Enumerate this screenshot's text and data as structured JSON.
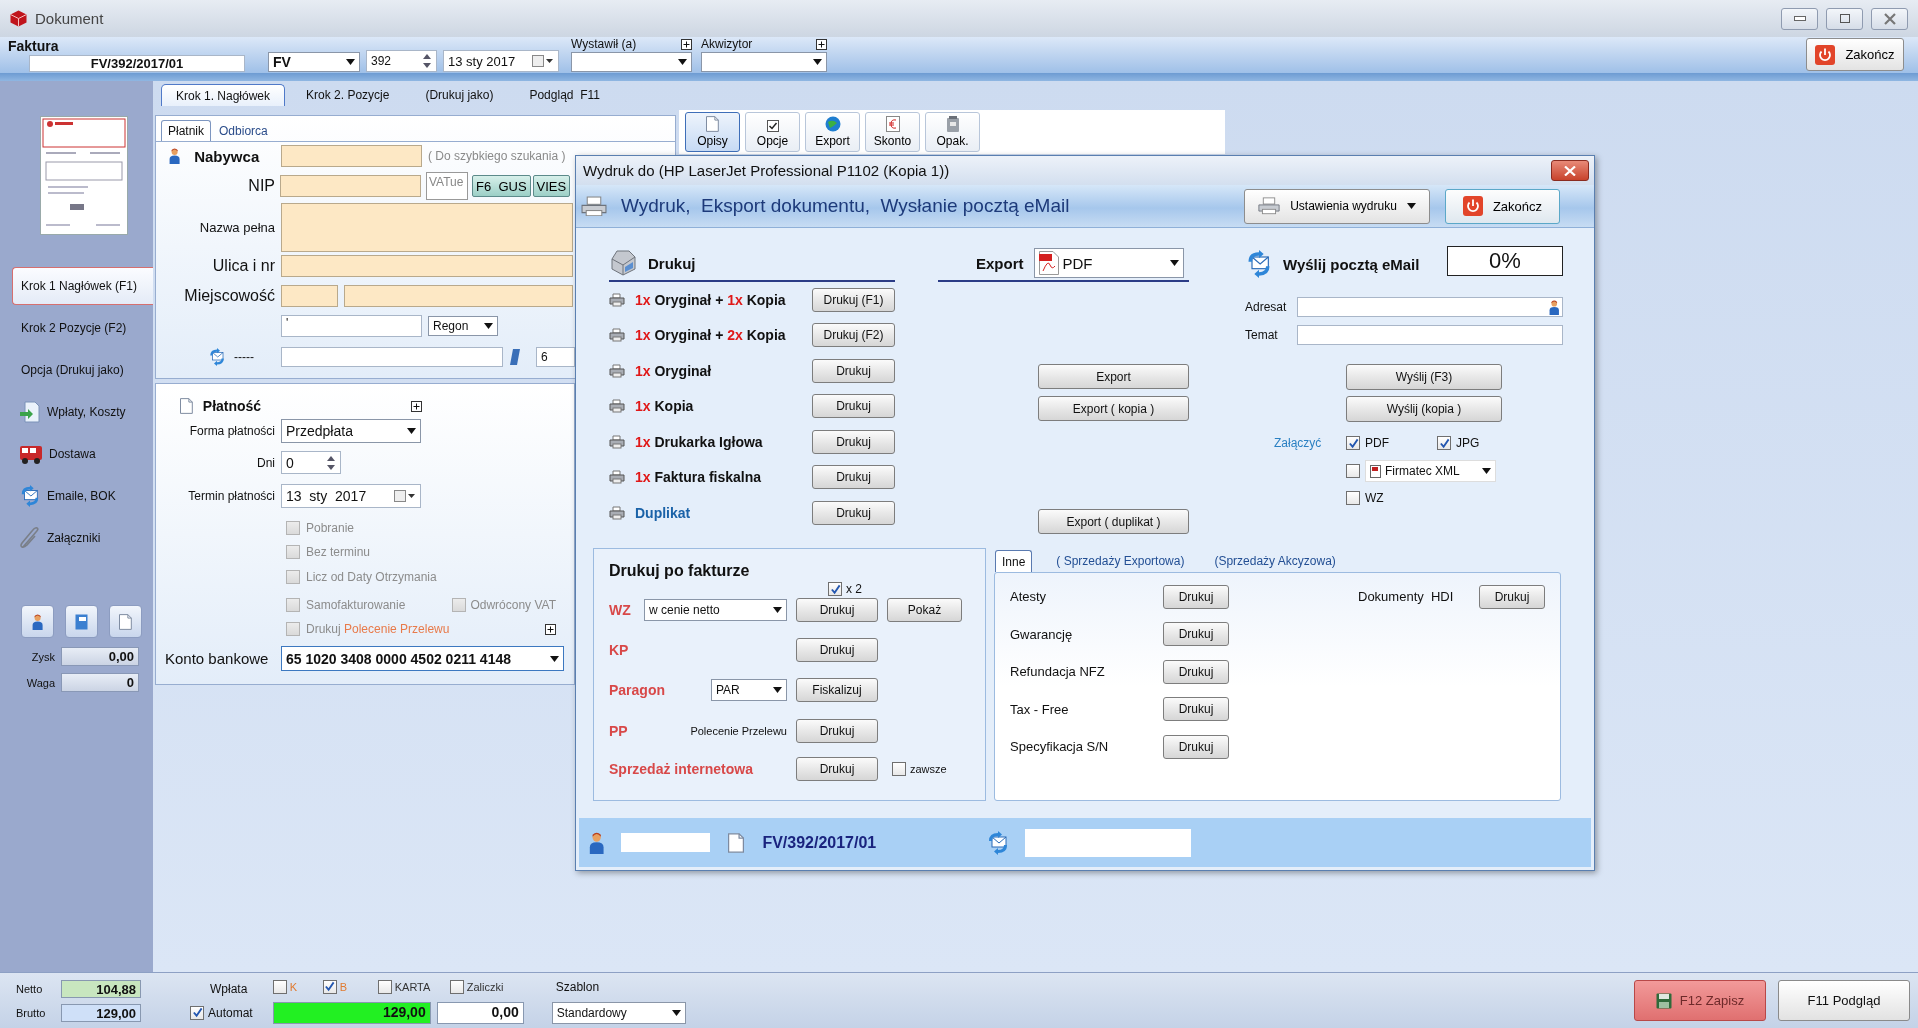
{
  "window": {
    "title": "Dokument"
  },
  "header": {
    "kind_label": "Faktura",
    "number": "FV/392/2017/01",
    "series": "FV",
    "sequence": "392",
    "date": "13 sty 2017",
    "issuer_label": "Wystawił (a)",
    "agent_label": "Akwizytor",
    "close_button": "Zakończ"
  },
  "steps": [
    {
      "label": "Krok 1. Nagłówek",
      "selected": true
    },
    {
      "label": "Krok 2. Pozycje",
      "selected": false
    },
    {
      "label": "(Drukuj jako)",
      "selected": false
    },
    {
      "label": "Podgląd  F11",
      "selected": false
    }
  ],
  "sidebar": {
    "items": [
      {
        "label": "Krok 1 Nagłówek (F1)",
        "kind": "step",
        "selected": true
      },
      {
        "label": "Krok 2 Pozycje (F2)",
        "kind": "step",
        "selected": false
      },
      {
        "label": "Opcja (Drukuj jako)",
        "kind": "step",
        "selected": false
      },
      {
        "label": "Wpłaty, Koszty",
        "kind": "link",
        "selected": false
      },
      {
        "label": "Dostawa",
        "kind": "link",
        "selected": false
      },
      {
        "label": "Emaile, BOK",
        "kind": "link",
        "selected": false
      },
      {
        "label": "Załączniki",
        "kind": "link",
        "selected": false
      }
    ],
    "stats": [
      {
        "label": "Zysk",
        "value": "0,00"
      },
      {
        "label": "Waga",
        "value": "0"
      }
    ]
  },
  "party": {
    "tabs": [
      {
        "label": "Płatnik",
        "selected": true
      },
      {
        "label": "Odbiorca",
        "selected": false
      }
    ],
    "title": "Nabywca",
    "search_hint": "( Do szybkiego szukania )",
    "nip_label": "NIP",
    "vat_ue": "VATue",
    "gus_button": "F6  GUS",
    "vies_button": "VIES",
    "full_name_label": "Nazwa pełna",
    "street_label": "Ulica i nr",
    "city_label": "Miejscowość",
    "id_value": "'",
    "id_type": "Regon",
    "phone_label": "-----",
    "phone_value": "6"
  },
  "toolbar": [
    {
      "label": "Opisy",
      "selected": true
    },
    {
      "label": "Opcje",
      "selected": false
    },
    {
      "label": "Export",
      "selected": false
    },
    {
      "label": "Skonto",
      "selected": false
    },
    {
      "label": "Opak.",
      "selected": false
    }
  ],
  "payment": {
    "title": "Płatność",
    "method_label": "Forma płatności",
    "method": "Przedpłata",
    "days_label": "Dni",
    "days": "0",
    "due_label": "Termin płatności",
    "due": "13  sty  2017",
    "options": [
      {
        "label": "Pobranie",
        "checked": false,
        "disabled": true
      },
      {
        "label": "Bez terminu",
        "checked": false,
        "disabled": true
      },
      {
        "label": "Licz od Daty Otrzymania",
        "checked": false,
        "disabled": true
      },
      {
        "label": "Samofakturowanie",
        "checked": false,
        "disabled": true
      },
      {
        "label": "Drukuj",
        "link": "Polecenie Przelewu",
        "checked": false,
        "disabled": true
      }
    ],
    "reverse_vat": {
      "label": "Odwrócony VAT",
      "checked": false,
      "disabled": true
    },
    "account_label": "Konto bankowe",
    "account": "65 1020 3408 0000 4502 0211 4148"
  },
  "print_dialog": {
    "title": "Wydruk do (HP LaserJet Professional P1102 (Kopia 1))",
    "heading": "Wydruk,  Eksport dokumentu,  Wysłanie pocztą eMail",
    "settings_button": "Ustawienia wydruku",
    "close_button": "Zakończ",
    "print": {
      "title": "Drukuj",
      "rows": [
        {
          "kind": "copies",
          "parts": [
            {
              "text": "1x",
              "highlight": true
            },
            {
              "text": " Oryginał + ",
              "highlight": false
            },
            {
              "text": "1x",
              "highlight": true
            },
            {
              "text": " Kopia",
              "highlight": false
            }
          ],
          "button": "Drukuj (F1)"
        },
        {
          "kind": "copies",
          "parts": [
            {
              "text": "1x",
              "highlight": true
            },
            {
              "text": " Oryginał + ",
              "highlight": false
            },
            {
              "text": "2x",
              "highlight": true
            },
            {
              "text": " Kopia",
              "highlight": false
            }
          ],
          "button": "Drukuj (F2)"
        },
        {
          "kind": "copies",
          "parts": [
            {
              "text": "1x",
              "highlight": true
            },
            {
              "text": " Oryginał",
              "highlight": false
            }
          ],
          "button": "Drukuj"
        },
        {
          "kind": "copies",
          "parts": [
            {
              "text": "1x",
              "highlight": true
            },
            {
              "text": " Kopia",
              "highlight": false
            }
          ],
          "button": "Drukuj"
        },
        {
          "kind": "copies",
          "parts": [
            {
              "text": "1x",
              "highlight": true
            },
            {
              "text": " Drukarka Igłowa",
              "highlight": false
            }
          ],
          "button": "Drukuj"
        },
        {
          "kind": "copies",
          "parts": [
            {
              "text": "1x",
              "highlight": true
            },
            {
              "text": " Faktura fiskalna",
              "highlight": false
            }
          ],
          "button": "Drukuj"
        },
        {
          "kind": "duplicate",
          "parts": [
            {
              "text": "Duplikat",
              "highlight": false
            }
          ],
          "button": "Drukuj"
        }
      ]
    },
    "export": {
      "title": "Export",
      "format": "PDF",
      "buttons": [
        "Export",
        "Export ( kopia )",
        "Export ( duplikat )"
      ]
    },
    "email": {
      "title": "Wyślij pocztą eMail",
      "progress": "0%",
      "to_label": "Adresat",
      "subject_label": "Temat",
      "buttons": [
        "Wyślij (F3)",
        "Wyślij (kopia )"
      ],
      "attach_label": "Załączyć",
      "attachments": [
        {
          "label": "PDF",
          "kind": "check",
          "checked": true
        },
        {
          "label": "JPG",
          "kind": "check",
          "checked": true
        },
        {
          "label": "Firmatec XML",
          "kind": "select",
          "checked": false
        },
        {
          "label": "WZ",
          "kind": "check",
          "checked": false
        }
      ]
    },
    "after_invoice": {
      "title": "Drukuj po fakturze",
      "double": {
        "label": "x 2",
        "checked": true
      },
      "rows": [
        {
          "label": "WZ",
          "kind": "select",
          "select": "w cenie netto",
          "buttons": [
            "Drukuj",
            "Pokaż"
          ]
        },
        {
          "label": "KP",
          "kind": "plain",
          "buttons": [
            "Drukuj"
          ]
        },
        {
          "label": "Paragon",
          "kind": "select",
          "select": "PAR",
          "buttons": [
            "Fiskalizuj"
          ]
        },
        {
          "label": "PP",
          "kind": "note",
          "note": "Polecenie Przelewu",
          "buttons": [
            "Drukuj"
          ]
        },
        {
          "label": "Sprzedaż internetowa",
          "kind": "check",
          "check": {
            "label": "zawsze",
            "checked": false
          },
          "buttons": [
            "Drukuj"
          ]
        }
      ]
    },
    "other": {
      "tabs": [
        {
          "label": "Inne",
          "selected": true
        },
        {
          "label": "( Sprzedaży Exportowa)",
          "selected": false
        },
        {
          "label": "(Sprzedaży Akcyzowa)",
          "selected": false
        }
      ],
      "items": [
        {
          "label": "Atesty",
          "button": "Drukuj"
        },
        {
          "label": "Gwarancję",
          "button": "Drukuj"
        },
        {
          "label": "Refundacja NFZ",
          "button": "Drukuj"
        },
        {
          "label": "Tax - Free",
          "button": "Drukuj"
        },
        {
          "label": "Specyfikacja S/N",
          "button": "Drukuj"
        }
      ],
      "extra": {
        "label": "Dokumenty  HDI",
        "button": "Drukuj"
      }
    },
    "footer": {
      "number": "FV/392/2017/01"
    }
  },
  "status_bar": {
    "net_label": "Netto",
    "net": "104,88",
    "gross_label": "Brutto",
    "gross": "129,00",
    "payment_label": "Wpłata",
    "auto": {
      "label": "Automat",
      "checked": true
    },
    "methods": [
      {
        "label": "K",
        "checked": false
      },
      {
        "label": "B",
        "checked": true
      },
      {
        "label": "KARTA",
        "checked": false
      },
      {
        "label": "Zaliczki",
        "checked": false
      }
    ],
    "paid": "129,00",
    "rest": "0,00",
    "template_label": "Szablon",
    "template": "Standardowy",
    "save_button": {
      "label": "F12 Zapisz",
      "disabled": true
    },
    "preview_button": "F11 Podgląd"
  }
}
